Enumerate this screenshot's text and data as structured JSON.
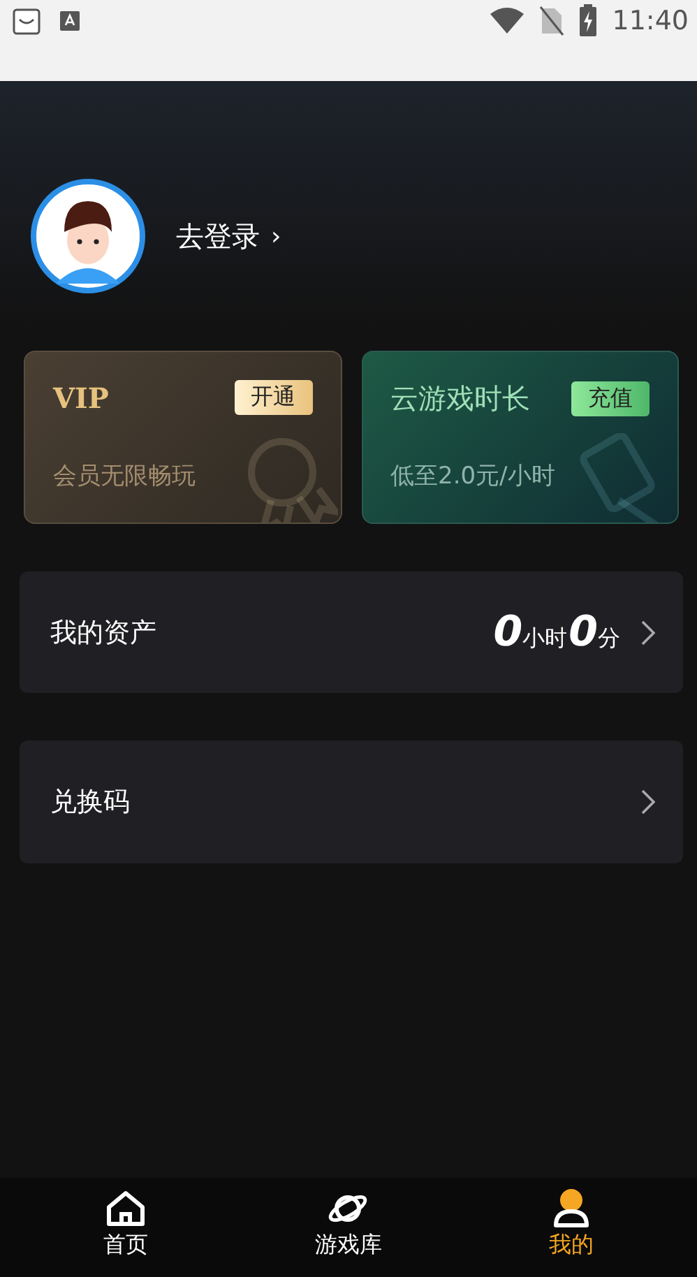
{
  "status_bar": {
    "time": "11:40"
  },
  "profile": {
    "login_label": "去登录",
    "chevron": "›"
  },
  "cards": [
    {
      "kind": "vip",
      "title": "VIP",
      "action": "开通",
      "subtitle": "会员无限畅玩"
    },
    {
      "kind": "time",
      "title": "云游戏时长",
      "action": "充值",
      "subtitle": "低至2.0元/小时"
    }
  ],
  "assets": {
    "label": "我的资产",
    "hours": "0",
    "hours_unit": "小时",
    "minutes": "0",
    "minutes_unit": "分"
  },
  "redeem": {
    "label": "兑换码"
  },
  "nav": [
    {
      "kind": "home",
      "label": "首页",
      "selected": false
    },
    {
      "kind": "planet",
      "label": "游戏库",
      "selected": false
    },
    {
      "kind": "user",
      "label": "我的",
      "selected": true
    }
  ]
}
